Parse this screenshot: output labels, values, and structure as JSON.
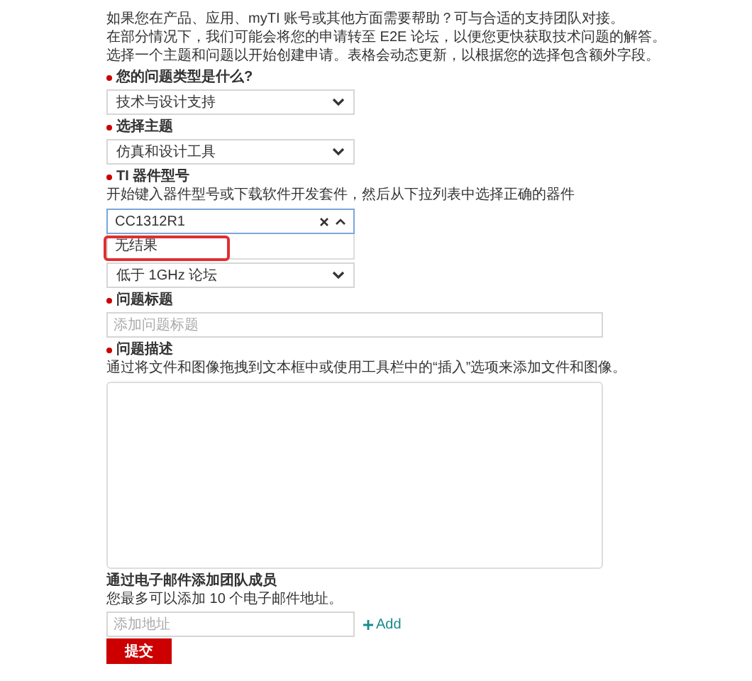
{
  "intro": [
    "如果您在产品、应用、myTI 账号或其他方面需要帮助？可与合适的支持团队对接。",
    "在部分情况下，我们可能会将您的申请转至 E2E 论坛，以便您更快获取技术问题的解答。",
    "选择一个主题和问题以开始创建申请。表格会动态更新，以根据您的选择包含额外字段。"
  ],
  "fields": [
    {
      "kind": "select",
      "label": "您的问题类型是什么?",
      "required": true,
      "value": "技术与设计支持"
    },
    {
      "kind": "select",
      "label": "选择主题",
      "required": true,
      "value": "仿真和设计工具"
    },
    {
      "kind": "combobox",
      "label": "TI 器件型号",
      "required": true,
      "hint": "开始键入器件型号或下载软件开发套件，然后从下拉列表中选择正确的器件",
      "value": "CC1312R1",
      "options": [
        {
          "text": "无结果",
          "highlighted": true
        }
      ]
    },
    {
      "kind": "select",
      "value": "低于 1GHz 论坛"
    },
    {
      "kind": "text",
      "label": "问题标题",
      "required": true,
      "placeholder": "添加问题标题"
    },
    {
      "kind": "textarea",
      "label": "问题描述",
      "required": true,
      "hint": "通过将文件和图像拖拽到文本框中或使用工具栏中的“插入”选项来添加文件和图像。"
    }
  ],
  "team": {
    "label": "通过电子邮件添加团队成员",
    "hint": "您最多可以添加 10 个电子邮件地址。",
    "placeholder": "添加地址",
    "add_label": "Add"
  },
  "submit": "提交"
}
